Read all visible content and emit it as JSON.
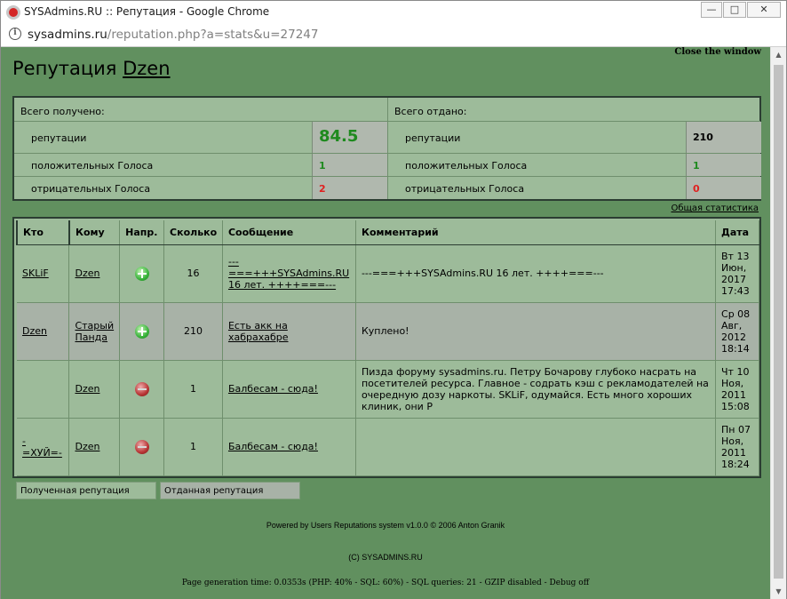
{
  "window": {
    "title": "SYSAdmins.RU :: Репутация - Google Chrome",
    "minimize": "—",
    "maximize": "□",
    "close": "✕"
  },
  "address": {
    "host": "sysadmins.ru",
    "path": "/reputation.php?a=stats&u=27247"
  },
  "page": {
    "close_window": "Close the window",
    "title_prefix": "Репутация",
    "user": "Dzen"
  },
  "summary": {
    "received": {
      "heading": "Всего получено:",
      "rows": [
        {
          "label": "репутации",
          "value": "84.5"
        },
        {
          "label": "положительных Голоса",
          "value": "1"
        },
        {
          "label": "отрицательных Голоса",
          "value": "2"
        }
      ]
    },
    "given": {
      "heading": "Всего отдано:",
      "rows": [
        {
          "label": "репутации",
          "value": "210"
        },
        {
          "label": "положительных Голоса",
          "value": "1"
        },
        {
          "label": "отрицательных Голоса",
          "value": "0"
        }
      ]
    },
    "general_stats_link": "Общая статистика"
  },
  "log": {
    "headers": [
      "Кто",
      "Кому",
      "Напр.",
      "Сколько",
      "Сообщение",
      "Комментарий",
      "Дата"
    ],
    "rows": [
      {
        "who": "SKLiF",
        "to": "Dzen",
        "dir": "plus",
        "amount": "16",
        "message": "---===+++SYSAdmins.RU 16 лет. ++++===---",
        "message_lines": [
          "---",
          "===+++SYSAdmins.RU",
          "16 лет. ++++===---"
        ],
        "comment": "---===+++SYSAdmins.RU 16 лет. ++++===---",
        "date": [
          "Вт 13",
          "Июн,",
          "2017",
          "17:43"
        ]
      },
      {
        "who": "Dzen",
        "to": "Старый Панда",
        "to_lines": [
          "Старый",
          "Панда"
        ],
        "dir": "plus",
        "amount": "210",
        "message": "Есть акк на хабрахабре",
        "comment": "Куплено!",
        "date": [
          "Ср 08",
          "Авг,",
          "2012",
          "18:14"
        ]
      },
      {
        "who": "",
        "to": "Dzen",
        "dir": "minus",
        "amount": "1",
        "message": "Балбесам - сюда!",
        "comment": "Пизда форуму sysadmins.ru. Петру Бочарову глубоко насрать на посетителей ресурса. Главное - содрать кэш с рекламодателей на очередную дозу наркоты. SKLiF, одумайся. Есть много хороших клиник, они Р",
        "date": [
          "Чт 10",
          "Ноя,",
          "2011",
          "15:08"
        ]
      },
      {
        "who": "-=ХУЙ=-",
        "who_lines": [
          "-",
          "=ХУЙ=-"
        ],
        "to": "Dzen",
        "dir": "minus",
        "amount": "1",
        "message": "Балбесам - сюда!",
        "comment": "",
        "date": [
          "Пн 07",
          "Ноя,",
          "2011",
          "18:24"
        ]
      }
    ]
  },
  "tabs": {
    "received": "Полученная репутация",
    "given": "Отданная репутация"
  },
  "footer": {
    "powered": "Powered by Users Reputations system v1.0.0 © 2006 Anton Granik",
    "copyright": "(C) SYSADMINS.RU",
    "debug": "Page generation time: 0.0353s (PHP: 40% - SQL: 60%) - SQL queries: 21 - GZIP disabled - Debug off"
  },
  "colors": {
    "page_bg": "#61905f",
    "table_bg": "#9dbb9a",
    "alt_row": "#a8b2a7",
    "positive": "#1e8a1e",
    "negative": "#e02020"
  }
}
